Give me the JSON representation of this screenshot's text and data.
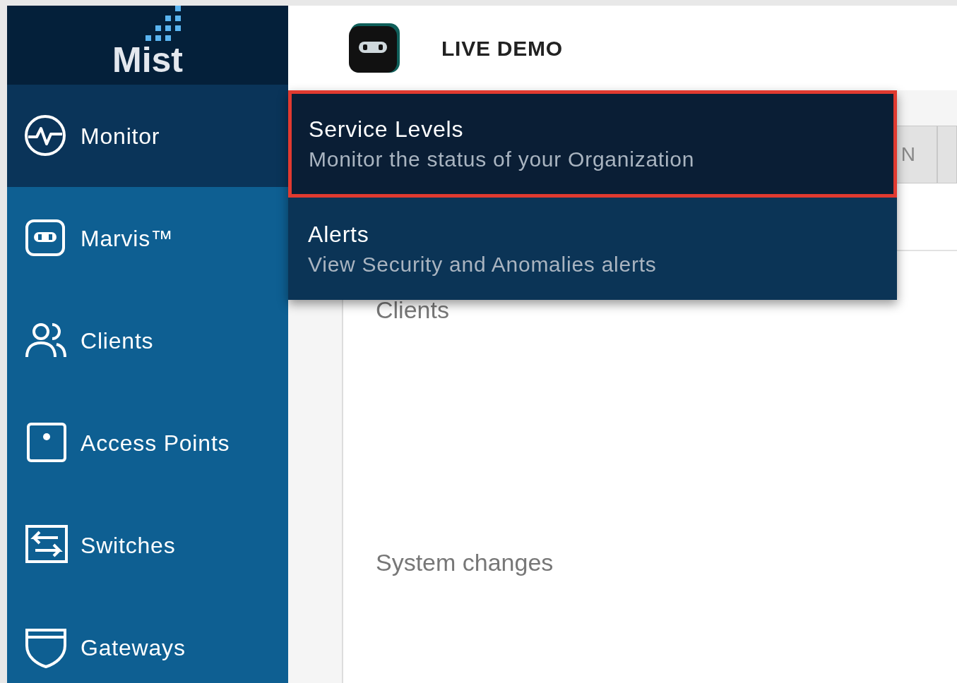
{
  "logo": {
    "text": "Mist"
  },
  "sidebar": {
    "items": [
      {
        "label": "Monitor",
        "kind": "monitor",
        "selected": true
      },
      {
        "label": "Marvis™",
        "kind": "robot",
        "selected": false
      },
      {
        "label": "Clients",
        "kind": "clients",
        "selected": false
      },
      {
        "label": "Access Points",
        "kind": "access-point",
        "selected": false
      },
      {
        "label": "Switches",
        "kind": "switch",
        "selected": false
      },
      {
        "label": "Gateways",
        "kind": "gateway",
        "selected": false
      }
    ]
  },
  "header": {
    "title": "LIVE DEMO"
  },
  "dropdown": {
    "items": [
      {
        "title": "Service Levels",
        "subtitle": "Monitor the status of your Organization",
        "selected": true
      },
      {
        "title": "Alerts",
        "subtitle": "View Security and Anomalies alerts",
        "selected": false
      }
    ]
  },
  "content": {
    "tab_fragment": "N",
    "sections": [
      "Clients",
      "System changes"
    ]
  }
}
